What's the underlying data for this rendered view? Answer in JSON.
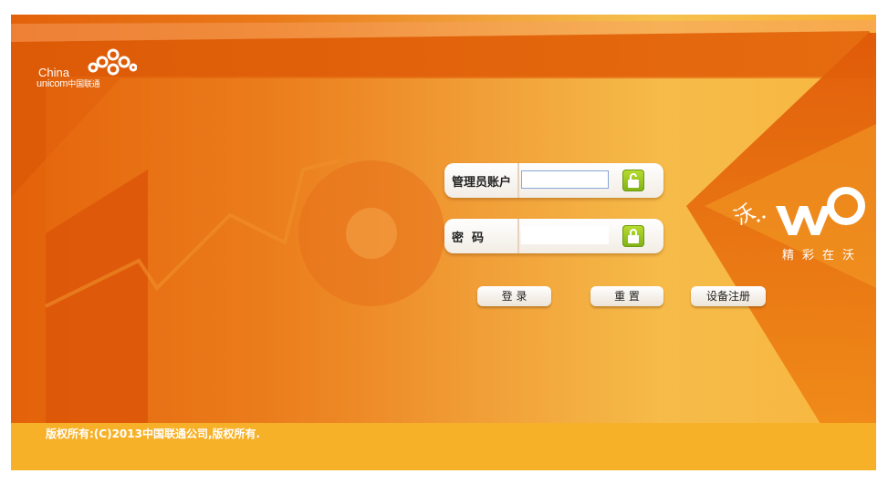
{
  "brand": {
    "logo_line1": "China",
    "logo_line2_en": "unicom",
    "logo_line2_cn": "中国联通",
    "wo_char": "沃",
    "wo_slogan": "精彩在沃"
  },
  "form": {
    "username_label": "管理员账户",
    "username_value": "",
    "password_label": "密  码",
    "password_value": ""
  },
  "buttons": {
    "login": "登 录",
    "reset": "重 置",
    "register": "设备注册"
  },
  "footer": {
    "copyright": "版权所有:(C)2013中国联通公司,版权所有."
  },
  "colors": {
    "accent_orange": "#e3610a",
    "accent_yellow": "#f6c14e",
    "lock_green": "#9bc620"
  }
}
